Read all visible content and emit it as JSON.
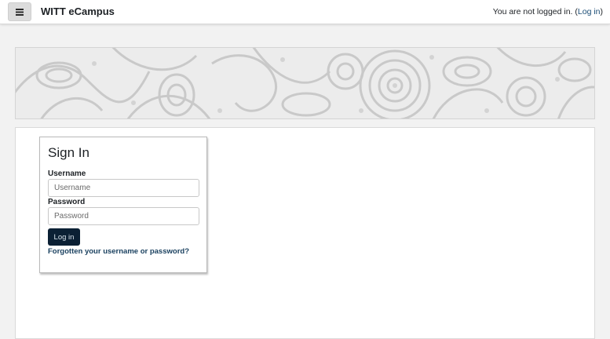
{
  "navbar": {
    "menu_icon": "hamburger-menu-icon",
    "site_name": "WITT eCampus",
    "login_status": {
      "prefix": "You are not logged in. (",
      "link_label": "Log in",
      "suffix": ")"
    }
  },
  "banner": {
    "pattern": "paisley-pattern"
  },
  "login": {
    "title": "Sign In",
    "username": {
      "label": "Username",
      "placeholder": "Username",
      "value": ""
    },
    "password": {
      "label": "Password",
      "placeholder": "Password",
      "value": ""
    },
    "submit_label": "Log in",
    "forgot_label": "Forgotten your username or password?"
  },
  "colors": {
    "page_background": "#f2f2f2",
    "button_background": "#0b2034",
    "link": "#183f5e",
    "banner_pattern": "#c9c9c9"
  }
}
